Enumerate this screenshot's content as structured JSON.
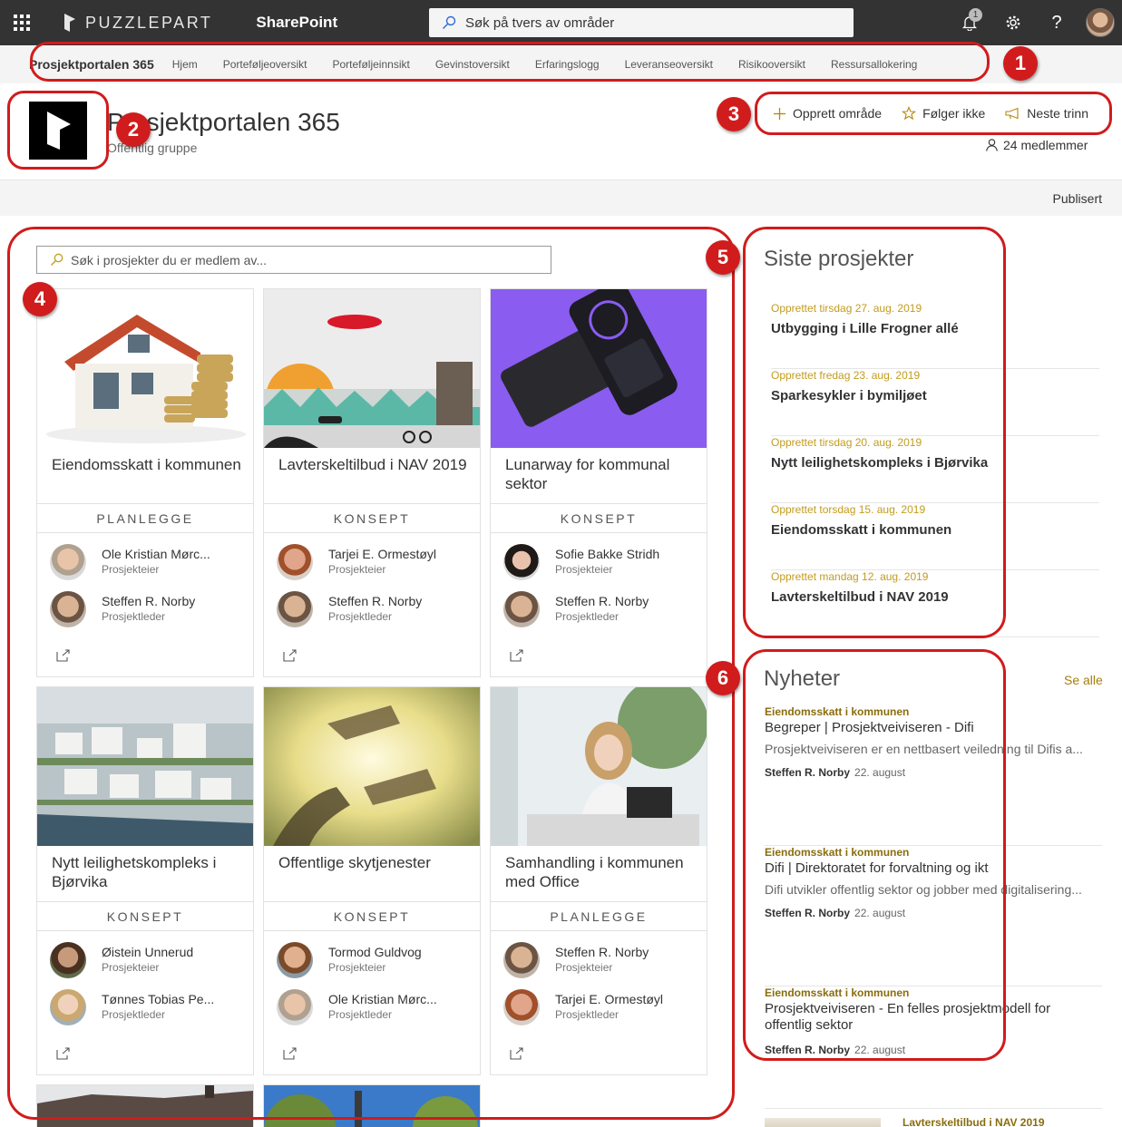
{
  "suitebar": {
    "brand": "PUZZLEPART",
    "app": "SharePoint",
    "search_placeholder": "Søk på tvers av områder",
    "notification_count": "1",
    "colors": {
      "bar": "#333334"
    }
  },
  "hubnav": {
    "title": "Prosjektportalen 365",
    "links": [
      "Hjem",
      "Porteføljeoversikt",
      "Porteføljeinnsikt",
      "Gevinstoversikt",
      "Erfaringslogg",
      "Leveranseoversikt",
      "Risikooversikt",
      "Ressursallokering"
    ]
  },
  "site": {
    "title": "Prosjektportalen 365",
    "subtitle": "Offentlig gruppe",
    "actions": {
      "create": "Opprett område",
      "follow": "Følger ikke",
      "next": "Neste trinn"
    },
    "members": "24 medlemmer"
  },
  "commandbar": {
    "status": "Publisert"
  },
  "projects": {
    "search_placeholder": "Søk i prosjekter du er medlem av...",
    "cards": [
      {
        "title": "Eiendomsskatt i kommunen",
        "phase": "PLANLEGGE",
        "people": [
          {
            "name": "Ole Kristian Mørc...",
            "role": "Prosjekteier"
          },
          {
            "name": "Steffen R. Norby",
            "role": "Prosjektleder"
          }
        ]
      },
      {
        "title": "Lavterskeltilbud i NAV 2019",
        "phase": "KONSEPT",
        "people": [
          {
            "name": "Tarjei E. Ormestøyl",
            "role": "Prosjekteier"
          },
          {
            "name": "Steffen R. Norby",
            "role": "Prosjektleder"
          }
        ]
      },
      {
        "title": "Lunarway for kommunal sektor",
        "phase": "KONSEPT",
        "people": [
          {
            "name": "Sofie Bakke Stridh",
            "role": "Prosjekteier"
          },
          {
            "name": "Steffen R. Norby",
            "role": "Prosjektleder"
          }
        ]
      },
      {
        "title": "Nytt leilighetskompleks i Bjørvika",
        "phase": "KONSEPT",
        "people": [
          {
            "name": "Øistein Unnerud",
            "role": "Prosjekteier"
          },
          {
            "name": "Tønnes Tobias Pe...",
            "role": "Prosjektleder"
          }
        ]
      },
      {
        "title": "Offentlige skytjenester",
        "phase": "KONSEPT",
        "people": [
          {
            "name": "Tormod Guldvog",
            "role": "Prosjekteier"
          },
          {
            "name": "Ole Kristian Mørc...",
            "role": "Prosjektleder"
          }
        ]
      },
      {
        "title": "Samhandling i kommunen med Office",
        "phase": "PLANLEGGE",
        "people": [
          {
            "name": "Steffen R. Norby",
            "role": "Prosjekteier"
          },
          {
            "name": "Tarjei E. Ormestøyl",
            "role": "Prosjektleder"
          }
        ]
      }
    ]
  },
  "recent": {
    "title": "Siste prosjekter",
    "items": [
      {
        "date": "Opprettet tirsdag 27. aug. 2019",
        "name": "Utbygging i Lille Frogner allé"
      },
      {
        "date": "Opprettet fredag 23. aug. 2019",
        "name": "Sparkesykler i bymiljøet"
      },
      {
        "date": "Opprettet tirsdag 20. aug. 2019",
        "name": "Nytt leilighetskompleks i Bjørvika"
      },
      {
        "date": "Opprettet torsdag 15. aug. 2019",
        "name": "Eiendomsskatt i kommunen"
      },
      {
        "date": "Opprettet mandag 12. aug. 2019",
        "name": "Lavterskeltilbud i NAV 2019"
      }
    ]
  },
  "news": {
    "title": "Nyheter",
    "see_all": "Se alle",
    "items": [
      {
        "site": "Eiendomsskatt i kommunen",
        "title": "Begreper | Prosjektveiviseren - Difi",
        "desc": "Prosjektveiviseren er en nettbasert veiledning til Difis a...",
        "author": "Steffen R. Norby",
        "date": "22. august"
      },
      {
        "site": "Eiendomsskatt i kommunen",
        "title": "Difi | Direktoratet for forvaltning og ikt",
        "desc": "Difi utvikler offentlig sektor og jobber med digitalisering...",
        "author": "Steffen R. Norby",
        "date": "22. august"
      },
      {
        "site": "Eiendomsskatt i kommunen",
        "title": "Prosjektveiviseren - En felles prosjektmodell for offentlig sektor",
        "desc": "",
        "author": "Steffen R. Norby",
        "date": "22. august"
      }
    ],
    "next_site": "Lavterskeltilbud i NAV 2019"
  },
  "annotations": [
    "1",
    "2",
    "3",
    "4",
    "5",
    "6"
  ],
  "colors": {
    "accent": "#c29c1e",
    "annotation": "#d01c1c"
  }
}
